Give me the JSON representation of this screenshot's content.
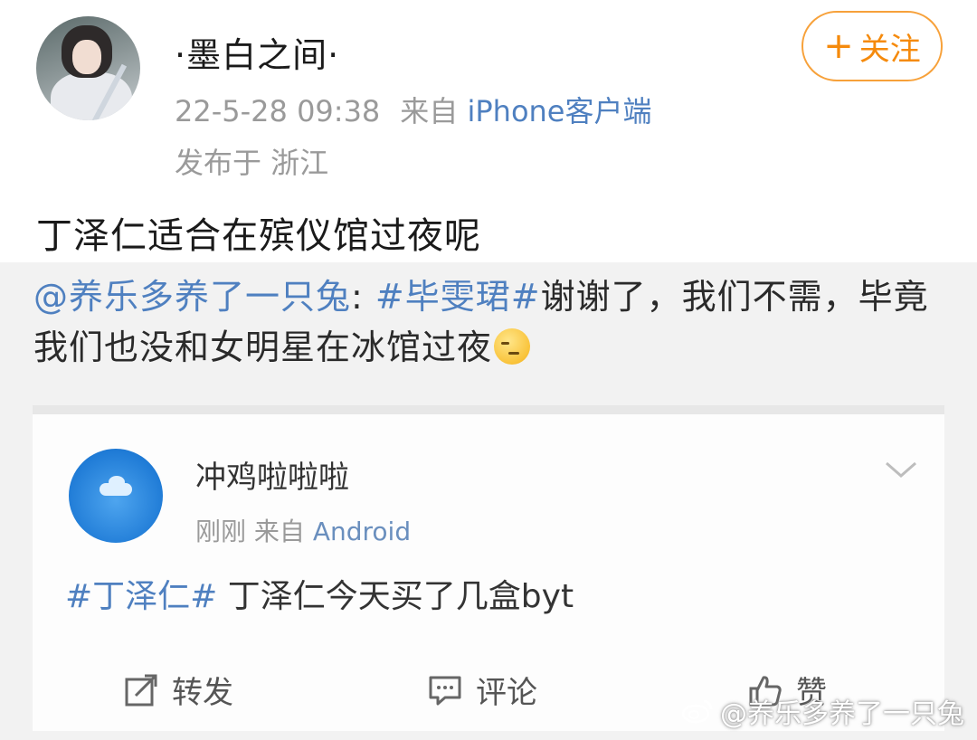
{
  "post": {
    "username": "·墨白之间·",
    "follow_label": "关注",
    "timestamp": "22-5-28 09:38",
    "from_label": "来自",
    "source": "iPhone客户端",
    "location": "发布于 浙江",
    "text": "丁泽仁适合在殡仪馆过夜呢"
  },
  "retweet": {
    "user": "@养乐多养了一只兔",
    "colon": ":",
    "topic": "#毕雯珺#",
    "text": "谢谢了，我们不需，毕竟我们也没和女明星在冰馆过夜",
    "emoji": "smirk-emoji"
  },
  "quoted_card": {
    "username": "冲鸡啦啦啦",
    "time": "刚刚",
    "from_label": "来自",
    "source": "Android",
    "topic": "#丁泽仁#",
    "text": "丁泽仁今天买了几盒byt",
    "actions": {
      "repost": "转发",
      "comment": "评论",
      "like": "赞"
    }
  },
  "watermark": {
    "text": "@养乐多养了一只兔"
  },
  "colors": {
    "follow_orange": "#f58a0c",
    "link_blue": "#4f80c0",
    "meta_gray": "#9a9a9a"
  }
}
